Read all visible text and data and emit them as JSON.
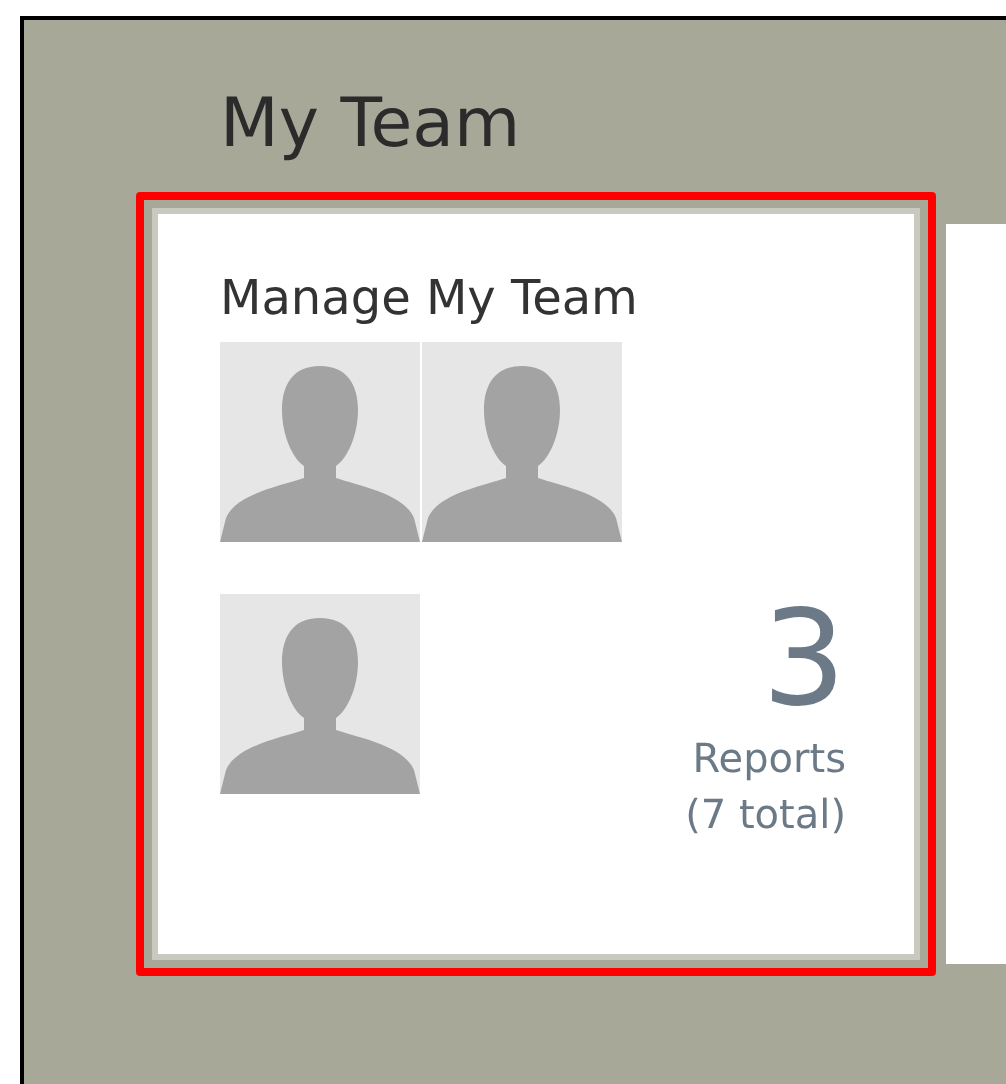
{
  "heading": "My Team",
  "tile": {
    "title": "Manage My Team",
    "highlighted": true,
    "avatars": [
      {
        "kind": "placeholder"
      },
      {
        "kind": "placeholder"
      },
      {
        "kind": "placeholder"
      }
    ],
    "count": "3",
    "count_label": "Reports",
    "total": "(7 total)"
  }
}
